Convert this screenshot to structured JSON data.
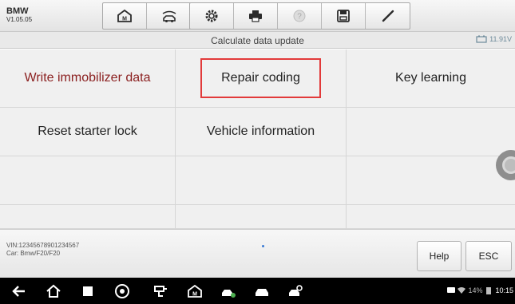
{
  "app": {
    "title": "BMW",
    "version": "V1.05.05"
  },
  "toolbar": {
    "icons": [
      "home-icon",
      "vehicle-swap-icon",
      "settings-gear-icon",
      "print-icon",
      "help-icon",
      "save-icon",
      "edit-icon"
    ]
  },
  "header": {
    "title": "Calculate data update",
    "battery_voltage": "11.91V"
  },
  "grid": {
    "rows": [
      [
        "Write immobilizer data",
        "Repair coding",
        "Key learning"
      ],
      [
        "Reset starter lock",
        "Vehicle information",
        ""
      ],
      [
        "",
        "",
        ""
      ],
      [
        "",
        "",
        ""
      ]
    ],
    "selected": "Repair coding"
  },
  "info": {
    "vin": "VIN:12345678901234567",
    "car": "Car: Bmw/F20/F20"
  },
  "buttons": {
    "help": "Help",
    "esc": "ESC"
  },
  "statusbar": {
    "battery": "14%",
    "time": "10:15"
  },
  "colors": {
    "highlight": "#e23a3a",
    "warning_text": "#8b2020"
  }
}
